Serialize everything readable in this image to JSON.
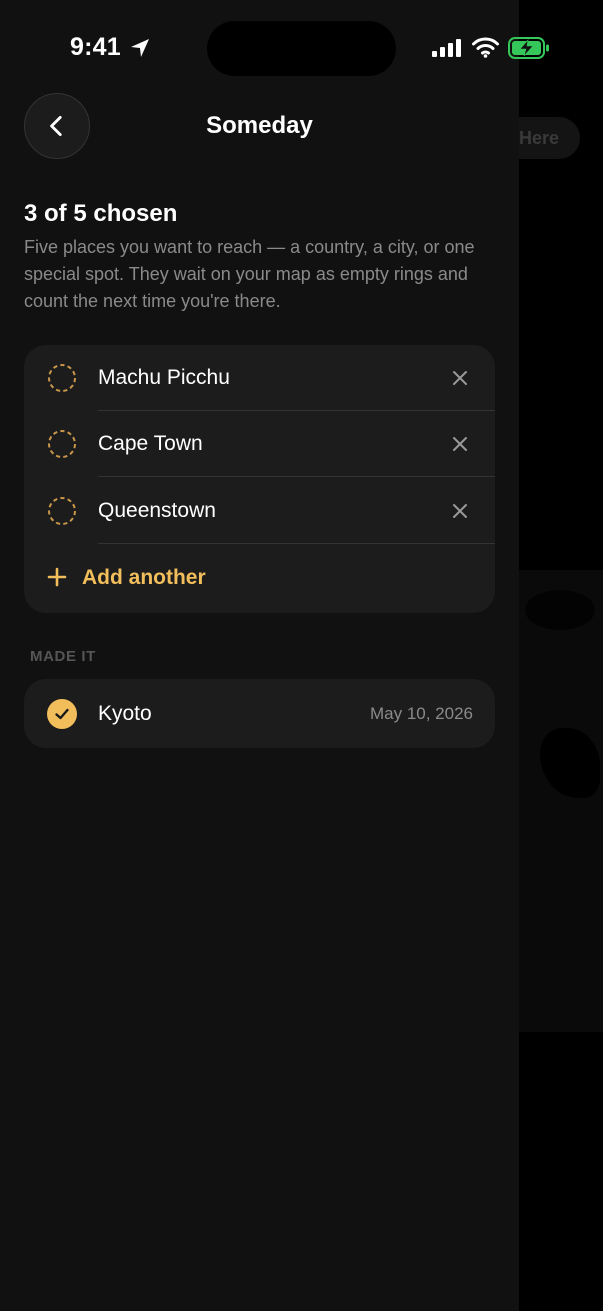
{
  "status_bar": {
    "time": "9:41"
  },
  "background": {
    "chip_label": "Here"
  },
  "header": {
    "title": "Someday"
  },
  "summary": {
    "count_text": "3 of 5 chosen",
    "description": "Five places you want to reach — a country, a city, or one special spot. They wait on your map as empty rings and count the next time you're there."
  },
  "wishlist": {
    "items": [
      {
        "label": "Machu Picchu"
      },
      {
        "label": "Cape Town"
      },
      {
        "label": "Queenstown"
      }
    ],
    "add_label": "Add another"
  },
  "made_it": {
    "section_label": "MADE IT",
    "items": [
      {
        "label": "Kyoto",
        "date": "May 10, 2026"
      }
    ]
  },
  "colors": {
    "accent": "#f2be5c",
    "sheet_bg": "#111111",
    "card_bg": "#1c1c1c",
    "secondary_text": "#8a8a8a",
    "battery_green": "#35c759"
  }
}
